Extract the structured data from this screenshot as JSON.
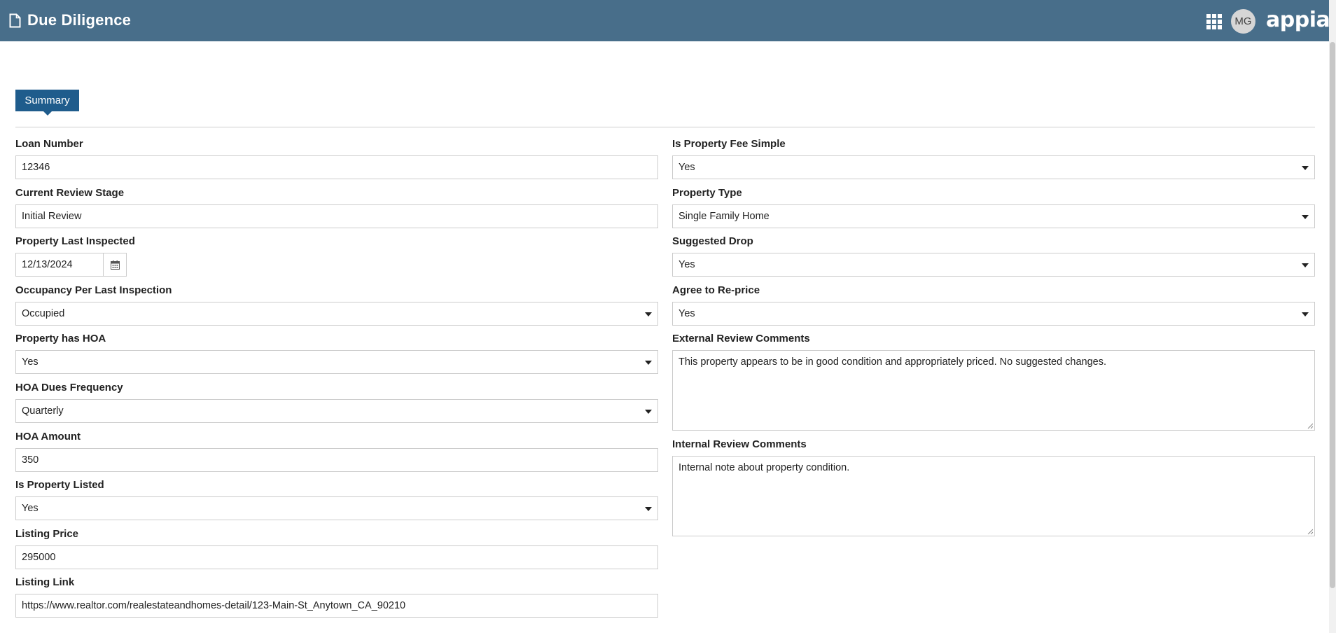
{
  "header": {
    "title": "Due Diligence",
    "avatar_initials": "MG",
    "logo_text": "appian"
  },
  "tabs": [
    {
      "label": "Summary",
      "active": true
    }
  ],
  "left_fields": [
    {
      "label": "Loan Number",
      "value": "12346",
      "type": "text"
    },
    {
      "label": "Current Review Stage",
      "value": "Initial Review",
      "type": "text"
    },
    {
      "label": "Property Last Inspected",
      "value": "12/13/2024",
      "type": "date"
    },
    {
      "label": "Occupancy Per Last Inspection",
      "value": "Occupied",
      "type": "select"
    },
    {
      "label": "Property has HOA",
      "value": "Yes",
      "type": "select"
    },
    {
      "label": "HOA Dues Frequency",
      "value": "Quarterly",
      "type": "select"
    },
    {
      "label": "HOA Amount",
      "value": "350",
      "type": "text"
    },
    {
      "label": "Is Property Listed",
      "value": "Yes",
      "type": "select"
    },
    {
      "label": "Listing Price",
      "value": "295000",
      "type": "text"
    },
    {
      "label": "Listing Link",
      "value": "https://www.realtor.com/realestateandhomes-detail/123-Main-St_Anytown_CA_90210",
      "type": "text"
    }
  ],
  "right_fields": [
    {
      "label": "Is Property Fee Simple",
      "value": "Yes",
      "type": "select"
    },
    {
      "label": "Property Type",
      "value": "Single Family Home",
      "type": "select"
    },
    {
      "label": "Suggested Drop",
      "value": "Yes",
      "type": "select"
    },
    {
      "label": "Agree to Re-price",
      "value": "Yes",
      "type": "select"
    },
    {
      "label": "External Review Comments",
      "value": "This property appears to be in good condition and appropriately priced. No suggested changes.",
      "type": "textarea"
    },
    {
      "label": "Internal Review Comments",
      "value": "Internal note about property condition.",
      "type": "textarea"
    }
  ],
  "colors": {
    "header_bg": "#486e8a",
    "tab_bg": "#1f5c8c",
    "border": "#cccccc"
  },
  "icons": [
    "document-icon",
    "app-grid-icon",
    "calendar-icon",
    "chevron-down-icon",
    "resize-handle-icon"
  ]
}
